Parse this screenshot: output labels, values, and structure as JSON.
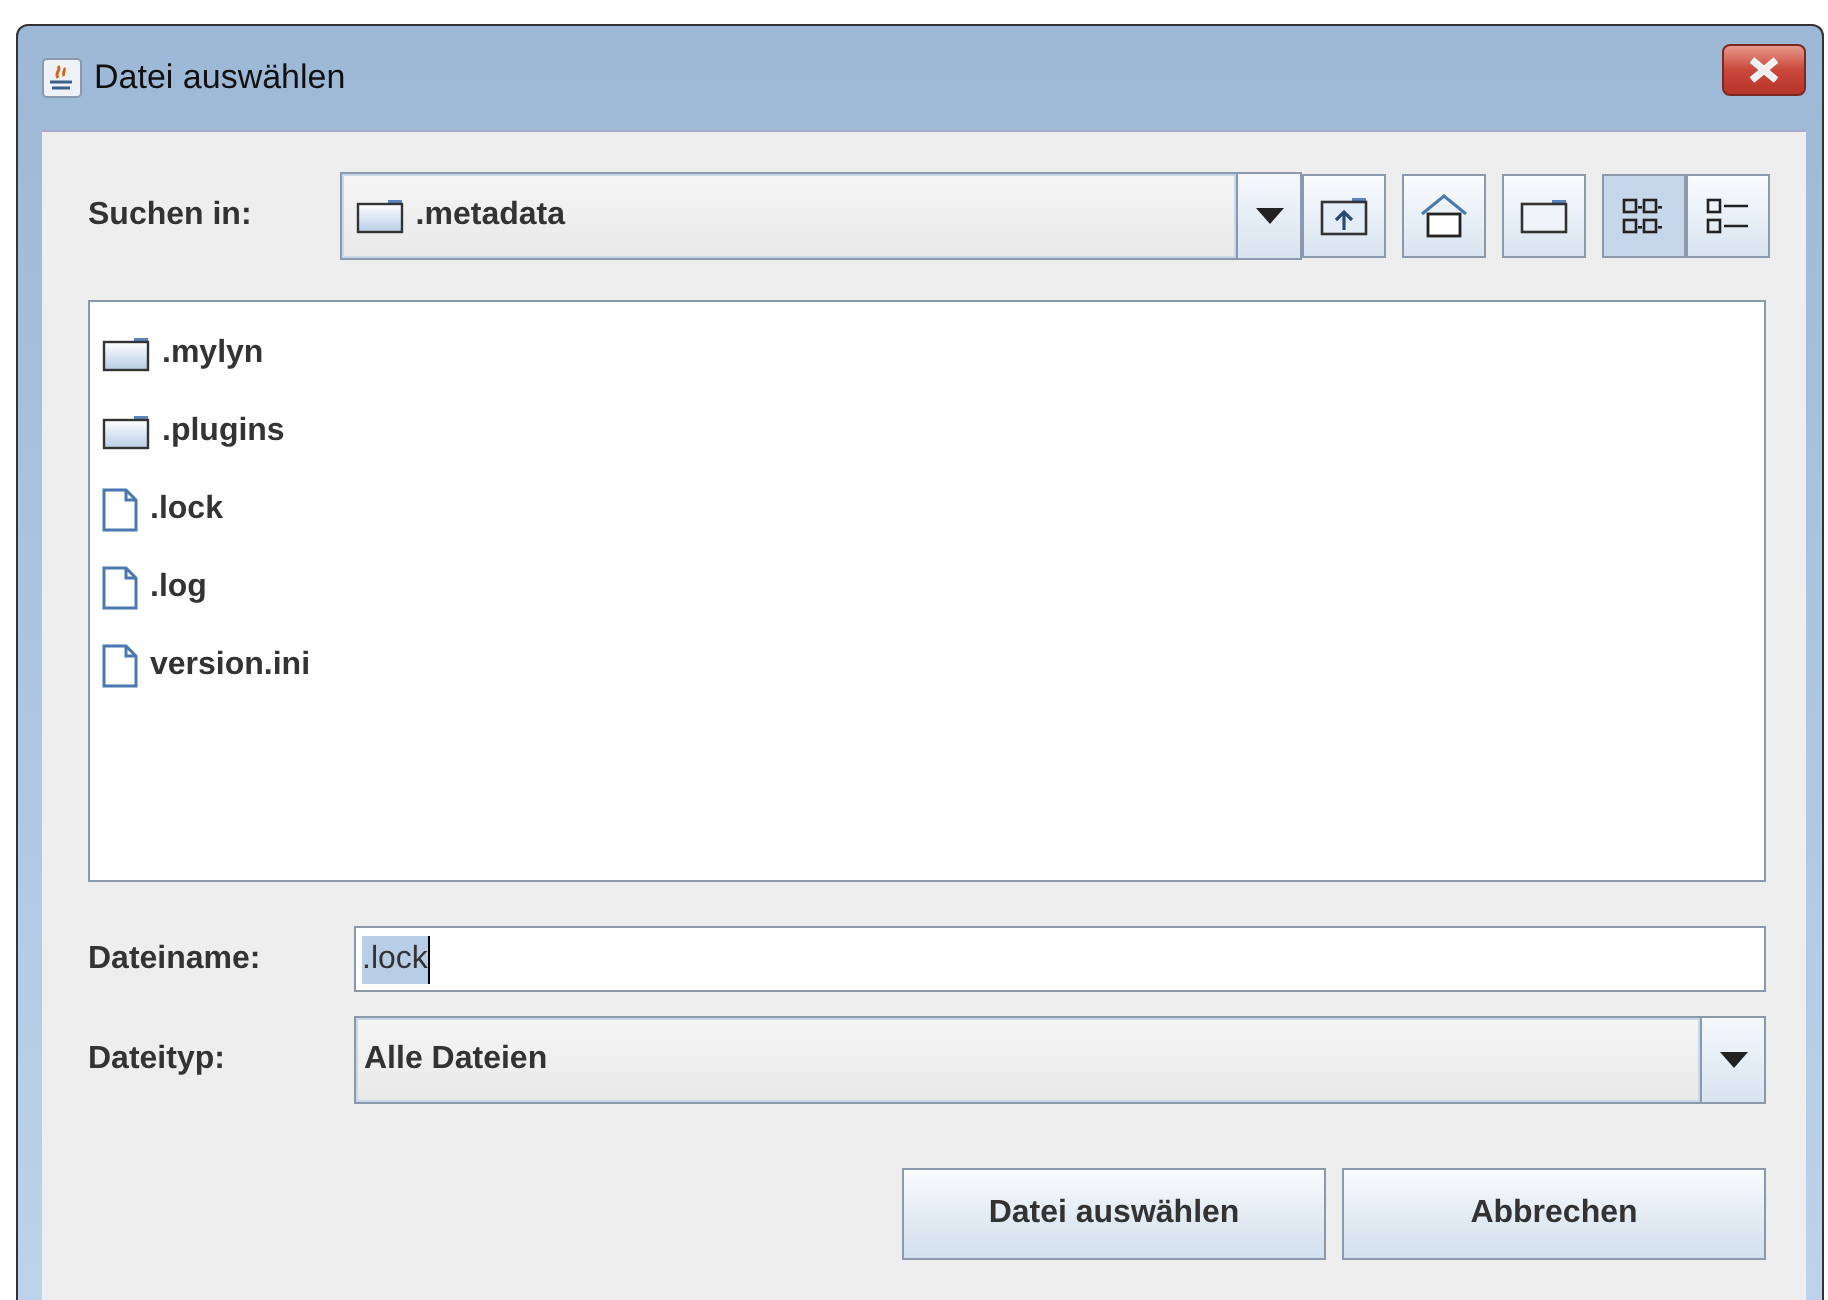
{
  "window": {
    "title": "Datei auswählen"
  },
  "look_in": {
    "label": "Suchen in:",
    "value": ".metadata"
  },
  "toolbar": [
    {
      "kind": "up",
      "selected": false
    },
    {
      "kind": "home",
      "selected": false
    },
    {
      "kind": "newfolder",
      "selected": false
    },
    {
      "kind": "list",
      "selected": true
    },
    {
      "kind": "details",
      "selected": false
    }
  ],
  "files": [
    {
      "name": ".mylyn",
      "kind": "folder"
    },
    {
      "name": ".plugins",
      "kind": "folder"
    },
    {
      "name": ".lock",
      "kind": "file"
    },
    {
      "name": ".log",
      "kind": "file"
    },
    {
      "name": "version.ini",
      "kind": "file"
    }
  ],
  "file_name": {
    "label": "Dateiname:",
    "value": ".lock",
    "text_selected": true
  },
  "file_type": {
    "label": "Dateityp:",
    "value": "Alle Dateien"
  },
  "buttons": [
    "Datei auswählen",
    "Abbrechen"
  ]
}
